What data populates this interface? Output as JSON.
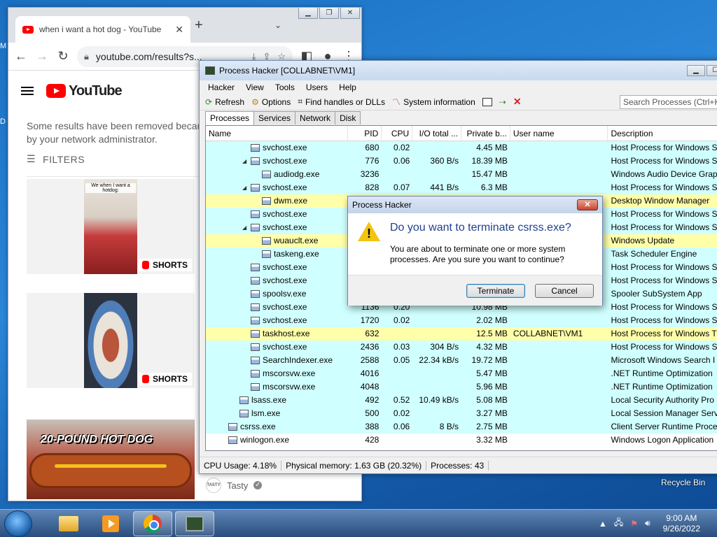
{
  "desktop": {
    "left_labels": [
      "M",
      "D"
    ],
    "recycle_bin": "Recycle Bin"
  },
  "chrome": {
    "tab_title": "when i want a hot dog - YouTube",
    "url": "youtube.com/results?s...",
    "youtube_logo": "YouTube",
    "notice": "Some results have been removed because they may not be appropriate by your network administrator.",
    "notice_line1": "Some results have been removed becau",
    "notice_line2": "by your network administrator.",
    "filters": "FILTERS",
    "videos": [
      {
        "thumb_text": "We when I want a hotdog:",
        "badge": "SHORTS"
      },
      {
        "thumb_text": "",
        "badge": "SHORTS"
      }
    ],
    "hotdog_title": "20-POUND HOT DOG",
    "channel_logo": "TASTY",
    "channel": "Tasty"
  },
  "ph": {
    "title": "Process Hacker [COLLABNET\\VM1]",
    "menu": [
      "Hacker",
      "View",
      "Tools",
      "Users",
      "Help"
    ],
    "toolbar": {
      "refresh": "Refresh",
      "options": "Options",
      "find": "Find handles or DLLs",
      "sysinfo": "System information",
      "search_placeholder": "Search Processes (Ctrl+K)"
    },
    "tabs": [
      "Processes",
      "Services",
      "Network",
      "Disk"
    ],
    "columns": [
      "Name",
      "PID",
      "CPU",
      "I/O total ...",
      "Private b...",
      "User name",
      "Description"
    ],
    "rows": [
      {
        "indent": 3,
        "tri": "",
        "name": "svchost.exe",
        "pid": "680",
        "cpu": "0.02",
        "io": "",
        "priv": "4.45 MB",
        "user": "",
        "desc": "Host Process for Windows S",
        "color": "cyan"
      },
      {
        "indent": 3,
        "tri": "◢",
        "name": "svchost.exe",
        "pid": "776",
        "cpu": "0.06",
        "io": "360 B/s",
        "priv": "18.39 MB",
        "user": "",
        "desc": "Host Process for Windows S",
        "color": "cyan"
      },
      {
        "indent": 4,
        "tri": "",
        "name": "audiodg.exe",
        "pid": "3236",
        "cpu": "",
        "io": "",
        "priv": "15.47 MB",
        "user": "",
        "desc": "Windows Audio Device Grap",
        "color": "cyan"
      },
      {
        "indent": 3,
        "tri": "◢",
        "name": "svchost.exe",
        "pid": "828",
        "cpu": "0.07",
        "io": "441 B/s",
        "priv": "6.3 MB",
        "user": "",
        "desc": "Host Process for Windows S",
        "color": "cyan"
      },
      {
        "indent": 4,
        "tri": "",
        "name": "dwm.exe",
        "pid": "",
        "cpu": "",
        "io": "",
        "priv": "",
        "user": "",
        "desc": "Desktop Window Manager",
        "color": "yellow"
      },
      {
        "indent": 3,
        "tri": "",
        "name": "svchost.exe",
        "pid": "",
        "cpu": "",
        "io": "",
        "priv": "",
        "user": "",
        "desc": "Host Process for Windows S",
        "color": "cyan"
      },
      {
        "indent": 3,
        "tri": "◢",
        "name": "svchost.exe",
        "pid": "",
        "cpu": "",
        "io": "",
        "priv": "",
        "user": "",
        "desc": "Host Process for Windows S",
        "color": "cyan"
      },
      {
        "indent": 4,
        "tri": "",
        "name": "wuauclt.exe",
        "pid": "",
        "cpu": "",
        "io": "",
        "priv": "",
        "user": "",
        "desc": "Windows Update",
        "color": "yellow"
      },
      {
        "indent": 4,
        "tri": "",
        "name": "taskeng.exe",
        "pid": "",
        "cpu": "",
        "io": "",
        "priv": "",
        "user": "",
        "desc": "Task Scheduler Engine",
        "color": "cyan"
      },
      {
        "indent": 3,
        "tri": "",
        "name": "svchost.exe",
        "pid": "",
        "cpu": "",
        "io": "",
        "priv": "",
        "user": "",
        "desc": "Host Process for Windows S",
        "color": "cyan"
      },
      {
        "indent": 3,
        "tri": "",
        "name": "svchost.exe",
        "pid": "",
        "cpu": "",
        "io": "",
        "priv": "",
        "user": "",
        "desc": "Host Process for Windows S",
        "color": "cyan"
      },
      {
        "indent": 3,
        "tri": "",
        "name": "spoolsv.exe",
        "pid": "",
        "cpu": "",
        "io": "",
        "priv": "",
        "user": "",
        "desc": "Spooler SubSystem App",
        "color": "cyan"
      },
      {
        "indent": 3,
        "tri": "",
        "name": "svchost.exe",
        "pid": "1136",
        "cpu": "0.20",
        "io": "",
        "priv": "10.98 MB",
        "user": "",
        "desc": "Host Process for Windows S",
        "color": "cyan"
      },
      {
        "indent": 3,
        "tri": "",
        "name": "svchost.exe",
        "pid": "1720",
        "cpu": "0.02",
        "io": "",
        "priv": "2.02 MB",
        "user": "",
        "desc": "Host Process for Windows S",
        "color": "cyan"
      },
      {
        "indent": 3,
        "tri": "",
        "name": "taskhost.exe",
        "pid": "632",
        "cpu": "",
        "io": "",
        "priv": "12.5 MB",
        "user": "COLLABNET\\VM1",
        "desc": "Host Process for Windows T",
        "color": "yellow"
      },
      {
        "indent": 3,
        "tri": "",
        "name": "svchost.exe",
        "pid": "2436",
        "cpu": "0.03",
        "io": "304 B/s",
        "priv": "4.32 MB",
        "user": "",
        "desc": "Host Process for Windows S",
        "color": "cyan"
      },
      {
        "indent": 3,
        "tri": "",
        "name": "SearchIndexer.exe",
        "pid": "2588",
        "cpu": "0.05",
        "io": "22.34 kB/s",
        "priv": "19.72 MB",
        "user": "",
        "desc": "Microsoft Windows Search I",
        "color": "cyan"
      },
      {
        "indent": 3,
        "tri": "",
        "name": "mscorsvw.exe",
        "pid": "4016",
        "cpu": "",
        "io": "",
        "priv": "5.47 MB",
        "user": "",
        "desc": ".NET Runtime Optimization",
        "color": "cyan"
      },
      {
        "indent": 3,
        "tri": "",
        "name": "mscorsvw.exe",
        "pid": "4048",
        "cpu": "",
        "io": "",
        "priv": "5.96 MB",
        "user": "",
        "desc": ".NET Runtime Optimization",
        "color": "cyan"
      },
      {
        "indent": 2,
        "tri": "",
        "name": "lsass.exe",
        "pid": "492",
        "cpu": "0.52",
        "io": "10.49 kB/s",
        "priv": "5.08 MB",
        "user": "",
        "desc": "Local Security Authority Pro",
        "color": "cyan"
      },
      {
        "indent": 2,
        "tri": "",
        "name": "lsm.exe",
        "pid": "500",
        "cpu": "0.02",
        "io": "",
        "priv": "3.27 MB",
        "user": "",
        "desc": "Local Session Manager Servi",
        "color": "cyan"
      },
      {
        "indent": 1,
        "tri": "",
        "name": "csrss.exe",
        "pid": "388",
        "cpu": "0.06",
        "io": "8 B/s",
        "priv": "2.75 MB",
        "user": "",
        "desc": "Client Server Runtime Proce",
        "color": "cyan"
      },
      {
        "indent": 1,
        "tri": "",
        "name": "winlogon.exe",
        "pid": "428",
        "cpu": "",
        "io": "",
        "priv": "3.32 MB",
        "user": "",
        "desc": "Windows Logon Application",
        "color": "white"
      }
    ],
    "status": {
      "cpu": "CPU Usage: 4.18%",
      "mem": "Physical memory: 1.63 GB (20.32%)",
      "procs": "Processes: 43"
    }
  },
  "dialog": {
    "title": "Process Hacker",
    "question": "Do you want to terminate csrss.exe?",
    "detail_line1": "You are about to terminate one or more system",
    "detail_line2": "processes. Are you sure you want to continue?",
    "terminate": "Terminate",
    "cancel": "Cancel"
  },
  "taskbar": {
    "time": "9:00 AM",
    "date": "9/26/2022"
  }
}
